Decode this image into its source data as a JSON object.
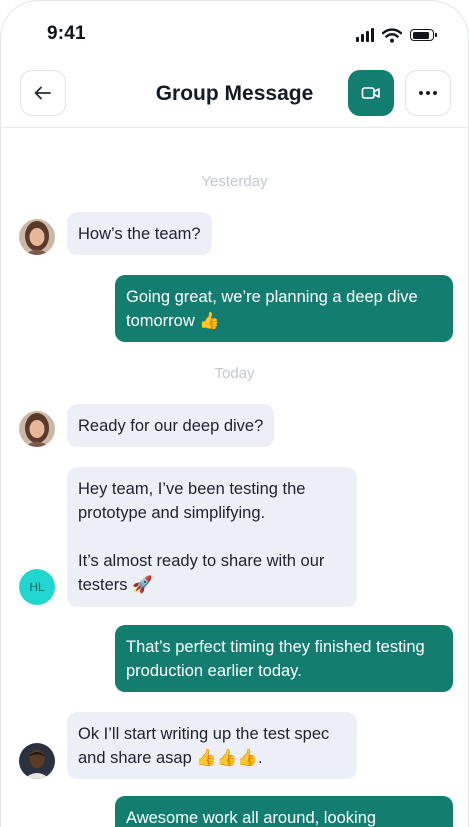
{
  "status_bar": {
    "time": "9:41"
  },
  "header": {
    "title": "Group Message"
  },
  "messages": [
    {
      "type": "divider",
      "text": "Yesterday"
    },
    {
      "type": "incoming",
      "text": "How’s the team?"
    },
    {
      "type": "outgoing",
      "text": "Going great, we’re planning a deep dive tomorrow 👍"
    },
    {
      "type": "divider",
      "text": "Today"
    },
    {
      "type": "incoming",
      "text": "Ready for our deep dive?"
    },
    {
      "type": "incoming",
      "text": "Hey team, I’ve been testing the prototype and simplifying.\n\nIt’s almost ready to share with our testers 🚀",
      "avatar_initials": "HL"
    },
    {
      "type": "outgoing",
      "text": "That’s perfect timing they finished testing production earlier today."
    },
    {
      "type": "incoming",
      "text": "Ok I’ll start writing up the test spec and share asap 👍👍👍."
    },
    {
      "type": "outgoing",
      "text": "Awesome work all around, looking"
    }
  ],
  "colors": {
    "accent": "#137e70",
    "incoming_bubble": "#eceff5",
    "initials_avatar": "#20d6cf"
  }
}
